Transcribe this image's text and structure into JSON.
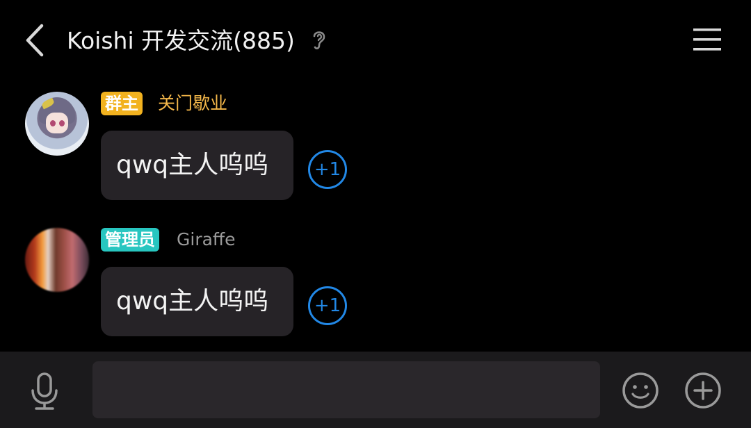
{
  "header": {
    "title": "Koishi 开发交流(885)"
  },
  "messages": [
    {
      "role_badge": "群主",
      "sender": "关门歇业",
      "text": "qwq主人呜呜",
      "plus_one": "+1"
    },
    {
      "role_badge": "管理员",
      "sender": "Giraffe",
      "text": "qwq主人呜呜",
      "plus_one": "+1"
    }
  ],
  "input": {
    "value": "",
    "placeholder": ""
  },
  "icons": {
    "back": "chevron-left-icon",
    "ear": "ear-icon",
    "menu": "menu-icon",
    "mic": "microphone-icon",
    "emoji": "smiley-icon",
    "plus": "plus-circle-icon"
  },
  "colors": {
    "owner_badge": "#f2b21f",
    "admin_badge": "#28c6c0",
    "owner_name": "#f5b84a",
    "admin_name": "#9b9b9b",
    "plus_one": "#2288e6",
    "bubble": "#262327",
    "input_bar": "#1b1a1c"
  }
}
